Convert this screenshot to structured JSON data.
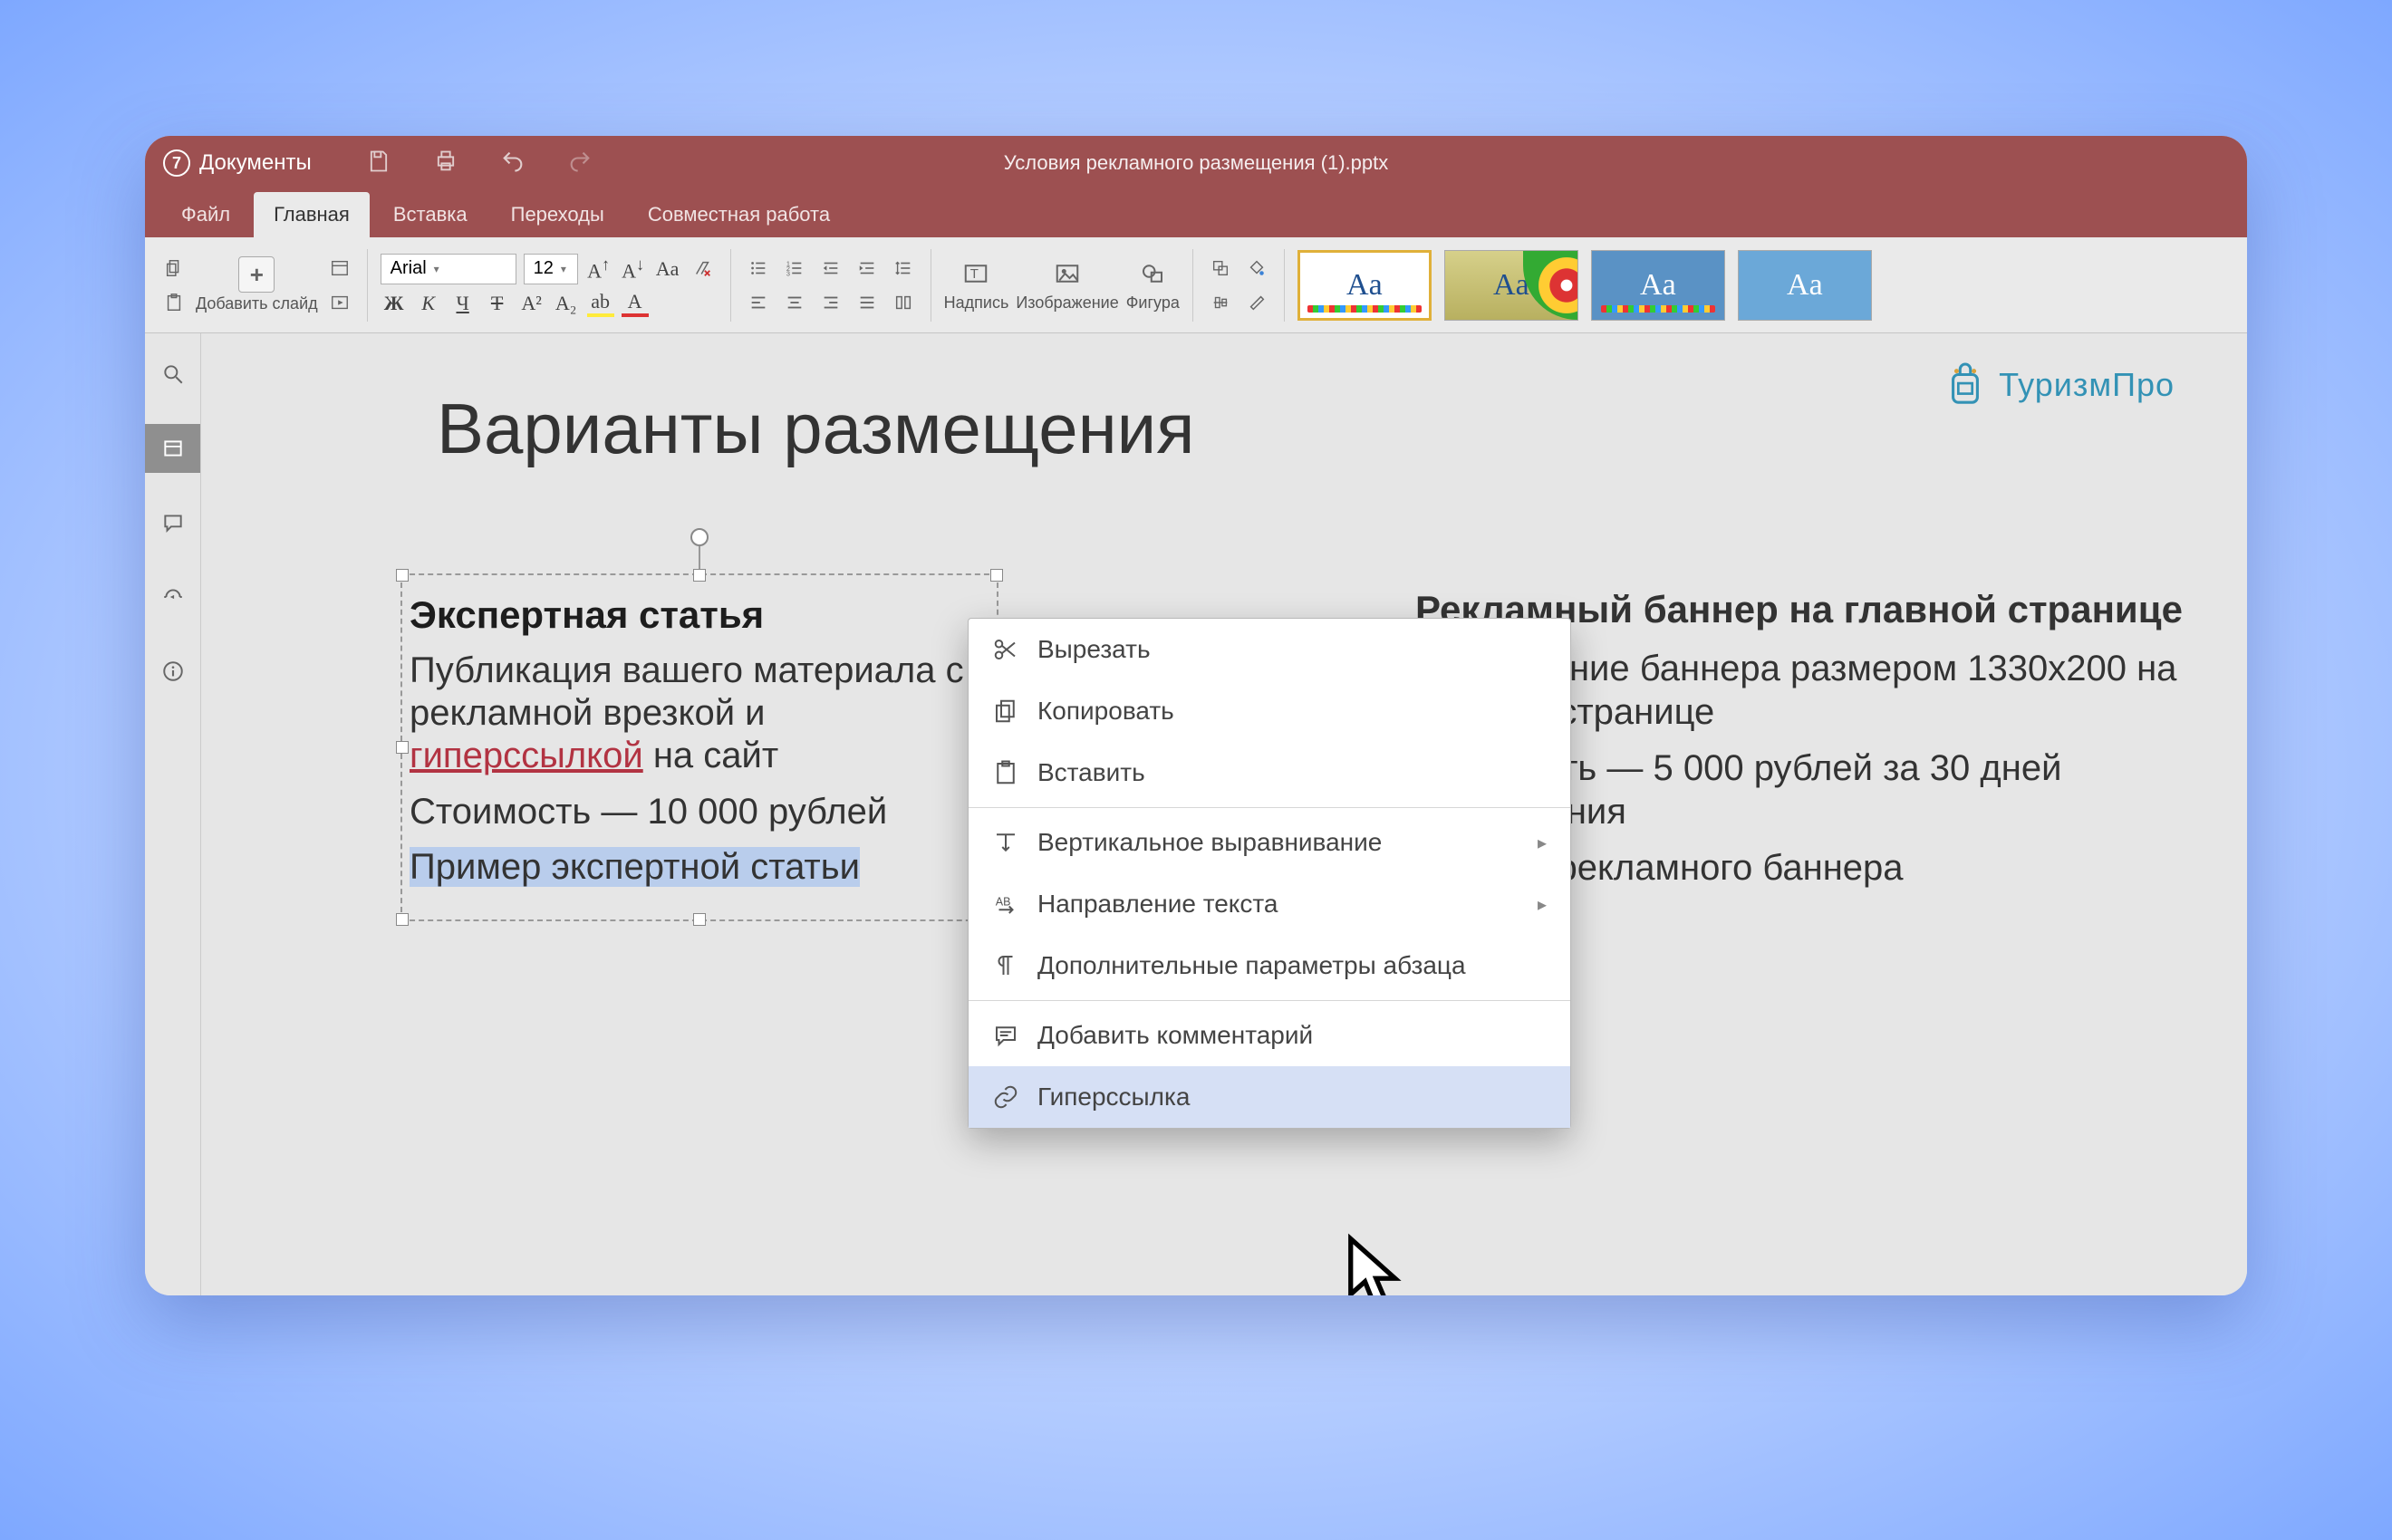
{
  "titlebar": {
    "app_label": "Документы",
    "doc_title": "Условия рекламного размещения (1).pptx"
  },
  "menubar": {
    "tabs": [
      {
        "label": "Файл",
        "active": false
      },
      {
        "label": "Главная",
        "active": true
      },
      {
        "label": "Вставка",
        "active": false
      },
      {
        "label": "Переходы",
        "active": false
      },
      {
        "label": "Совместная работа",
        "active": false
      }
    ]
  },
  "ribbon": {
    "add_slide_label": "Добавить слайд",
    "font_name": "Arial",
    "font_size": "12",
    "caption_label": "Надпись",
    "image_label": "Изображение",
    "shape_label": "Фигура",
    "theme_aa": "Aa"
  },
  "brand": {
    "name": "ТуризмПро"
  },
  "slide": {
    "title": "Варианты размещения",
    "left_box": {
      "heading": "Экспертная статья",
      "p1_prefix": "Публикация вашего материала с рекламной врезкой и ",
      "p1_link": "гиперссылкой",
      "p1_suffix": " на сайт",
      "p2": "Стоимость — 10 000 рублей",
      "p3_selected": "Пример экспертной статьи"
    },
    "right_box": {
      "heading": "Рекламный баннер на главной странице",
      "p1": "Размещение баннера размером 1330х200 на главной странице",
      "p2": "Стоимость — 5 000 рублей за 30 дней размещения",
      "p3": "Пример рекламного баннера"
    }
  },
  "context_menu": {
    "items": [
      {
        "id": "cut",
        "label": "Вырезать",
        "hasSubmenu": false
      },
      {
        "id": "copy",
        "label": "Копировать",
        "hasSubmenu": false
      },
      {
        "id": "paste",
        "label": "Вставить",
        "hasSubmenu": false
      },
      {
        "sep": true
      },
      {
        "id": "valign",
        "label": "Вертикальное выравнивание",
        "hasSubmenu": true
      },
      {
        "id": "textdir",
        "label": "Направление текста",
        "hasSubmenu": true
      },
      {
        "id": "paraopts",
        "label": "Дополнительные параметры абзаца",
        "hasSubmenu": false
      },
      {
        "sep": true
      },
      {
        "id": "comment",
        "label": "Добавить комментарий",
        "hasSubmenu": false
      },
      {
        "id": "hyperlink",
        "label": "Гиперссылка",
        "hasSubmenu": false,
        "hover": true
      }
    ]
  }
}
